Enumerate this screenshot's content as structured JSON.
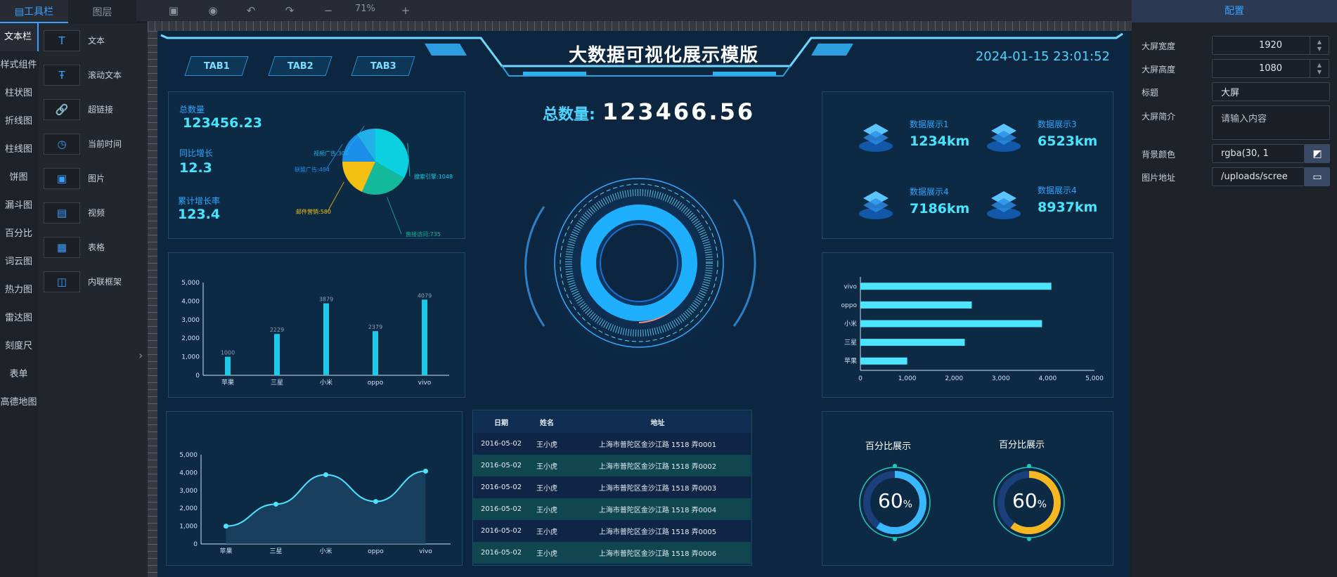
{
  "left_tabs": [
    {
      "label": "▤工具栏",
      "active": true
    },
    {
      "label": "图层",
      "active": false
    }
  ],
  "toolbar": {
    "zoom": "71%",
    "icons": [
      "save-icon",
      "preview-icon",
      "undo-icon",
      "redo-icon",
      "zoom-out-icon",
      "zoom-in-icon"
    ]
  },
  "categories": [
    "文本栏",
    "样式组件",
    "柱状图",
    "折线图",
    "柱线图",
    "饼图",
    "漏斗图",
    "百分比",
    "词云图",
    "热力图",
    "雷达图",
    "刻度尺",
    "表单",
    "高德地图"
  ],
  "components": [
    {
      "label": "文本",
      "icon": "text-icon",
      "glyph": "T"
    },
    {
      "label": "滚动文本",
      "icon": "scroll-text-icon",
      "glyph": "Ŧ"
    },
    {
      "label": "超链接",
      "icon": "link-icon",
      "glyph": "🔗"
    },
    {
      "label": "当前时间",
      "icon": "clock-icon",
      "glyph": "◷"
    },
    {
      "label": "图片",
      "icon": "image-icon",
      "glyph": "▣"
    },
    {
      "label": "视频",
      "icon": "video-icon",
      "glyph": "▤"
    },
    {
      "label": "表格",
      "icon": "table-icon",
      "glyph": "▦"
    },
    {
      "label": "内联框架",
      "icon": "iframe-icon",
      "glyph": "◫"
    }
  ],
  "dashboard": {
    "title": "大数据可视化展示模版",
    "datetime": "2024-01-15 23:01:52",
    "tabs": [
      "TAB1",
      "TAB2",
      "TAB3"
    ],
    "stats": [
      {
        "label": "总数量",
        "value": "123456.23"
      },
      {
        "label": "同比增长",
        "value": "12.3"
      },
      {
        "label": "累计增长率",
        "value": "123.4"
      }
    ],
    "total_label": "总数量:",
    "total_value": "123466.56",
    "displays": [
      {
        "label": "数据展示1",
        "value": "1234km"
      },
      {
        "label": "数据展示3",
        "value": "6523km"
      },
      {
        "label": "数据展示4",
        "value": "7186km"
      },
      {
        "label": "数据展示4",
        "value": "8937km"
      }
    ],
    "table": {
      "headers": [
        "日期",
        "姓名",
        "地址"
      ],
      "rows": [
        [
          "2016-05-02",
          "王小虎",
          "上海市普陀区金沙江路 1518 弄0001"
        ],
        [
          "2016-05-02",
          "王小虎",
          "上海市普陀区金沙江路 1518 弄0002"
        ],
        [
          "2016-05-02",
          "王小虎",
          "上海市普陀区金沙江路 1518 弄0003"
        ],
        [
          "2016-05-02",
          "王小虎",
          "上海市普陀区金沙江路 1518 弄0004"
        ],
        [
          "2016-05-02",
          "王小虎",
          "上海市普陀区金沙江路 1518 弄0005"
        ],
        [
          "2016-05-02",
          "王小虎",
          "上海市普陀区金沙江路 1518 弄0006"
        ]
      ]
    },
    "gauges": [
      {
        "title": "百分比展示",
        "value": "60",
        "unit": "%",
        "color": "#3ab8ff"
      },
      {
        "title": "百分比展示",
        "value": "60",
        "unit": "%",
        "color": "#f5b820"
      }
    ]
  },
  "config": {
    "header": "配置",
    "fields": [
      {
        "label": "大屏宽度",
        "value": "1920"
      },
      {
        "label": "大屏高度",
        "value": "1080"
      },
      {
        "label": "标题",
        "value": "大屏"
      },
      {
        "label": "大屏简介",
        "placeholder": "请输入内容"
      },
      {
        "label": "背景颜色",
        "value": "rgba(30, 1"
      },
      {
        "label": "图片地址",
        "value": "/uploads/scree"
      }
    ]
  },
  "chart_data": [
    {
      "type": "pie",
      "slices": [
        {
          "name": "搜索引擎",
          "value": 1048,
          "color": "#0ad0e0"
        },
        {
          "name": "直接访问",
          "value": 735,
          "color": "#14b89a"
        },
        {
          "name": "邮件营销",
          "value": 580,
          "color": "#f5c014"
        },
        {
          "name": "联盟广告",
          "value": 484,
          "color": "#1a8ee8"
        },
        {
          "name": "视频广告",
          "value": 300,
          "color": "#22b0e8"
        }
      ],
      "labels": [
        "搜索引擎:1048",
        "直接访问:735",
        "邮件营销:580",
        "联盟广告:484",
        "视频广告:300"
      ]
    },
    {
      "type": "bar",
      "categories": [
        "苹果",
        "三星",
        "小米",
        "oppo",
        "vivo"
      ],
      "values": [
        1000,
        2229,
        3879,
        2379,
        4079
      ],
      "ylim": [
        0,
        5000
      ],
      "yticks": [
        "0",
        "1,000",
        "2,000",
        "3,000",
        "4,000",
        "5,000"
      ]
    },
    {
      "type": "bar",
      "orientation": "horizontal",
      "categories": [
        "苹果",
        "三星",
        "小米",
        "oppo",
        "vivo"
      ],
      "values": [
        1000,
        2229,
        3879,
        2379,
        4079
      ],
      "xlim": [
        0,
        5000
      ],
      "xticks": [
        "0",
        "1,000",
        "2,000",
        "3,000",
        "4,000",
        "5,000"
      ]
    },
    {
      "type": "area",
      "categories": [
        "苹果",
        "三星",
        "小米",
        "oppo",
        "vivo"
      ],
      "values": [
        1000,
        2229,
        3879,
        2379,
        4079
      ],
      "ylim": [
        0,
        5000
      ],
      "yticks": [
        "0",
        "1,000",
        "2,000",
        "3,000",
        "4,000",
        "5,000"
      ]
    }
  ]
}
